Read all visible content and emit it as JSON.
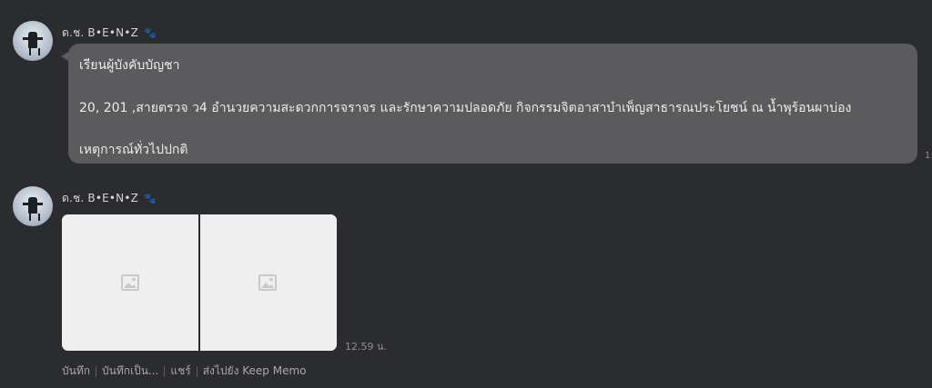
{
  "messages": [
    {
      "sender": "ด.ช. B•E•N•Z",
      "lines": [
        "เรียนผู้บังคับบัญชา",
        "20, 201 ,สายตรวจ ว4 อำนวยความสะดวกการจราจร และรักษาความปลอดภัย กิจกรรมจิตอาสาบำเพ็ญสาธารณประโยชน์ ณ น้ำพุร้อนผาบ่อง",
        "เหตุการณ์ทั่วไปปกติ"
      ],
      "time_partial": "1:"
    },
    {
      "sender": "ด.ช. B•E•N•Z",
      "time": "12.59 น.",
      "actions": [
        "บันทึก",
        "บันทึกเป็น...",
        "แชร์",
        "ส่งไปยัง Keep Memo"
      ]
    }
  ],
  "colors": {
    "background": "#2b2c2f",
    "bubble": "#5b5b5d",
    "paw": "#9b8fd6"
  },
  "icons": {
    "paw": "paw-icon",
    "image_placeholder": "image-placeholder-icon"
  }
}
